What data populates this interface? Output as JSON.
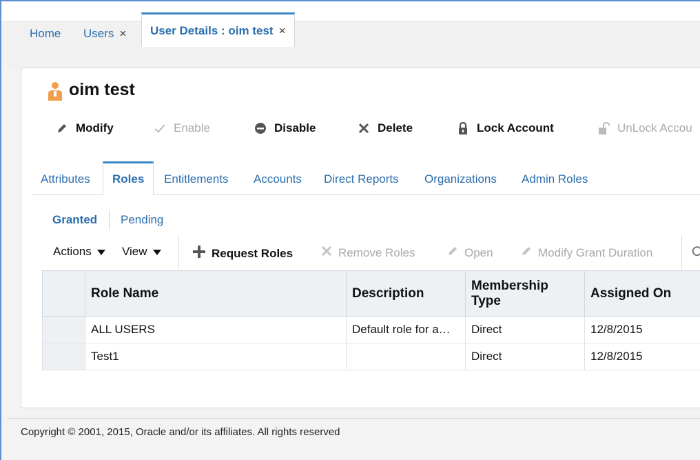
{
  "page_tabs": [
    {
      "label": "Home"
    },
    {
      "label": "Users"
    },
    {
      "label": "User Details : oim test"
    }
  ],
  "user": {
    "name": "oim test"
  },
  "actions": {
    "modify": "Modify",
    "enable": "Enable",
    "disable": "Disable",
    "delete": "Delete",
    "lock": "Lock Account",
    "unlock": "UnLock Accou"
  },
  "detail_tabs": [
    "Attributes",
    "Roles",
    "Entitlements",
    "Accounts",
    "Direct Reports",
    "Organizations",
    "Admin Roles"
  ],
  "sub_tabs": [
    "Granted",
    "Pending"
  ],
  "toolbar": {
    "actions": "Actions",
    "view": "View",
    "request_roles": "Request Roles",
    "remove_roles": "Remove Roles",
    "open": "Open",
    "modify_grant": "Modify Grant Duration"
  },
  "table": {
    "columns": [
      "Role Name",
      "Description",
      "Membership Type",
      "Assigned On"
    ],
    "rows": [
      [
        "ALL USERS",
        "Default role for a…",
        "Direct",
        "12/8/2015"
      ],
      [
        "Test1",
        "",
        "Direct",
        "12/8/2015"
      ]
    ]
  },
  "footer": {
    "copyright": "Copyright © 2001, 2015, Oracle and/or its affiliates. All rights reserved"
  },
  "colors": {
    "link": "#2b6ead",
    "accent": "#3a86c8",
    "user_icon": "#f0a04b"
  }
}
